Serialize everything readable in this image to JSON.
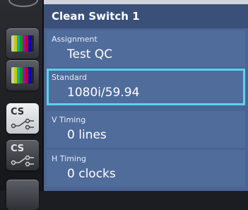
{
  "panel": {
    "title": "Clean Switch 1",
    "fields": [
      {
        "label": "Assignment",
        "value": "Test QC"
      },
      {
        "label": "Standard",
        "value": "1080i/59.94"
      },
      {
        "label": "V Timing",
        "value": "0 lines"
      },
      {
        "label": "H Timing",
        "value": "0 clocks"
      }
    ]
  },
  "sidebar": {
    "tiles": [
      {
        "icon": "color-bars-icon",
        "text": ""
      },
      {
        "icon": "color-bars-icon",
        "text": ""
      },
      {
        "icon": "clean-switch-icon",
        "text": "CS"
      },
      {
        "icon": "clean-switch-icon",
        "text": "CS"
      }
    ]
  },
  "colors": {
    "panel": "#4a6593",
    "title_bar": "#3a5078",
    "field": "#506c9b",
    "selection": "#5ad3ef"
  }
}
